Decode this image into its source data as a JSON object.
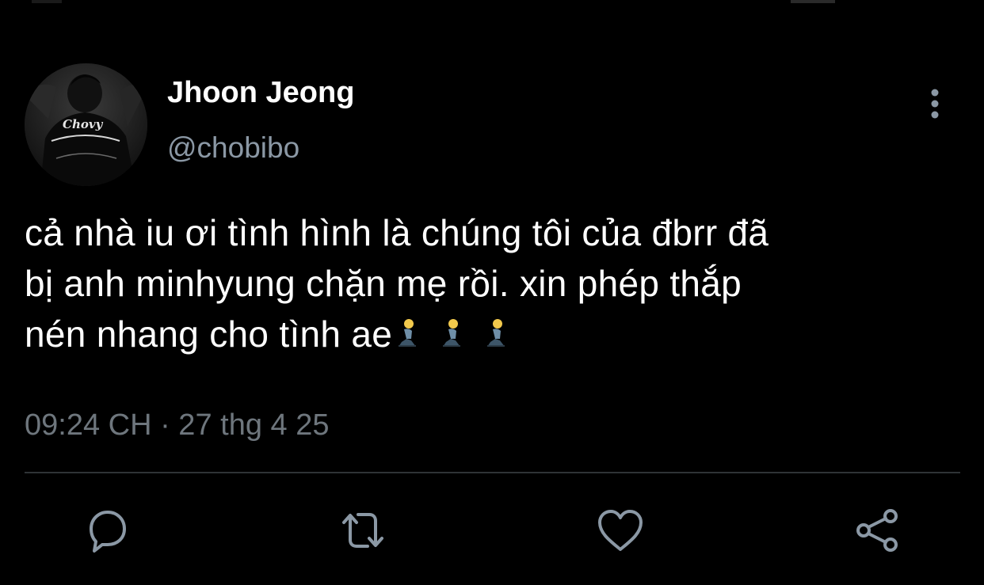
{
  "tweet": {
    "author": {
      "display_name": "Jhoon Jeong",
      "handle": "@chobibo",
      "avatar_icon": "user-avatar-photo",
      "avatar_jacket_text": "Chovy"
    },
    "text_lines": [
      "cả nhà iu ơi tình hình là chúng tôi của đbrr đã",
      "bị anh minhyung chặn mẹ rồi. xin phép thắp",
      "nén nhang cho tình ae"
    ],
    "emoji": [
      "🧎",
      "🧎",
      "🧎"
    ],
    "timestamp": "09:24 CH · 27 thg 4 25"
  },
  "actions": [
    {
      "name": "reply",
      "icon": "comment-icon"
    },
    {
      "name": "retweet",
      "icon": "retweet-icon"
    },
    {
      "name": "like",
      "icon": "heart-icon"
    },
    {
      "name": "share",
      "icon": "share-icon"
    }
  ],
  "colors": {
    "background": "#000000",
    "primary_text": "#ffffff",
    "secondary_text": "#8b98a5",
    "timestamp_text": "#6e767d",
    "icon": "#8b98a5",
    "divider": "#2f3336"
  }
}
